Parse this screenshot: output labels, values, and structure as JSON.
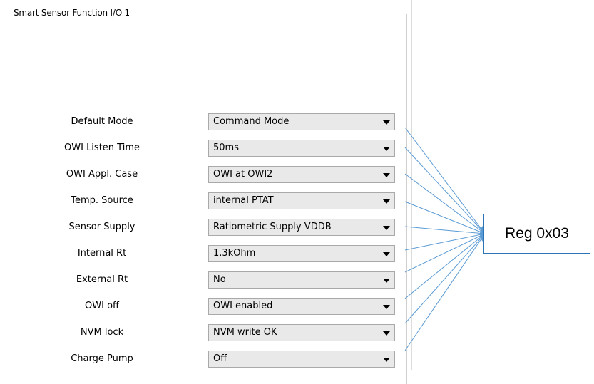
{
  "group": {
    "title": "Smart Sensor Function I/O 1"
  },
  "rows": [
    {
      "label": "Default Mode",
      "value": "Command Mode"
    },
    {
      "label": "OWI Listen Time",
      "value": "50ms"
    },
    {
      "label": "OWI Appl. Case",
      "value": "OWI at OWI2"
    },
    {
      "label": "Temp. Source",
      "value": "internal PTAT"
    },
    {
      "label": "Sensor Supply",
      "value": "Ratiometric Supply VDDB"
    },
    {
      "label": "Internal Rt",
      "value": "1.3kOhm"
    },
    {
      "label": "External Rt",
      "value": "No"
    },
    {
      "label": "OWI off",
      "value": "OWI enabled"
    },
    {
      "label": "NVM lock",
      "value": "NVM write OK"
    },
    {
      "label": "Charge Pump",
      "value": "Off"
    }
  ],
  "callout": {
    "text": "Reg 0x03",
    "border_color": "#2e74b5",
    "line_color": "#5b9bd5"
  },
  "icons": {
    "dropdown": "chevron-down-icon"
  }
}
